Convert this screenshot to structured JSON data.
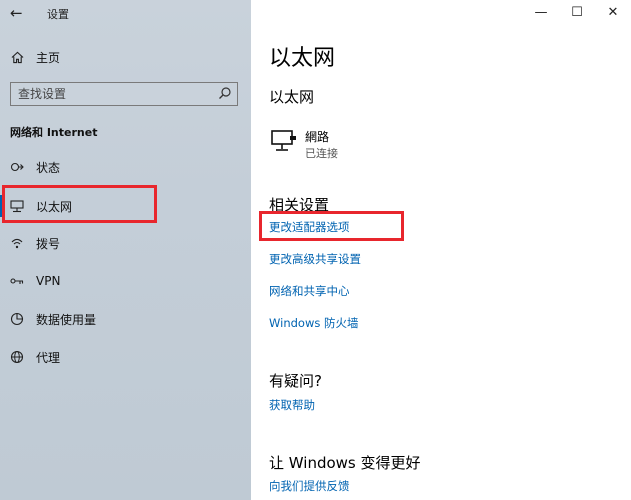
{
  "window": {
    "app_title": "设置",
    "back_icon": "back-arrow-icon",
    "controls": {
      "minimize": "—",
      "maximize": "☐",
      "close": "✕"
    }
  },
  "sidebar": {
    "home_label": "主页",
    "search_placeholder": "查找设置",
    "section_heading": "网络和 Internet",
    "items": [
      {
        "label": "状态",
        "icon": "status-icon"
      },
      {
        "label": "以太网",
        "icon": "ethernet-icon",
        "active": true
      },
      {
        "label": "拨号",
        "icon": "dialup-icon"
      },
      {
        "label": "VPN",
        "icon": "vpn-icon"
      },
      {
        "label": "数据使用量",
        "icon": "data-usage-icon"
      },
      {
        "label": "代理",
        "icon": "proxy-icon"
      }
    ]
  },
  "main": {
    "title": "以太网",
    "subtitle": "以太网",
    "network": {
      "name": "網路",
      "status": "已连接"
    },
    "related": {
      "title": "相关设置",
      "links": [
        "更改适配器选项",
        "更改高级共享设置",
        "网络和共享中心",
        "Windows 防火墙"
      ]
    },
    "question": {
      "title": "有疑问?",
      "link": "获取帮助"
    },
    "feedback": {
      "title": "让 Windows 变得更好",
      "link": "向我们提供反馈"
    }
  },
  "colors": {
    "accent": "#0063b1",
    "highlight_box": "#e8262d",
    "sidebar_bg": "#c7d0d9"
  }
}
